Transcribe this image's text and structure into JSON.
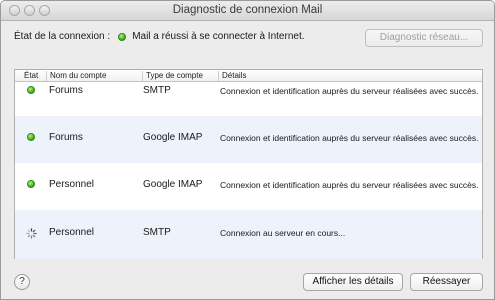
{
  "window": {
    "title": "Diagnostic de connexion Mail"
  },
  "status": {
    "label": "État de la connexion :",
    "message": "Mail a réussi à se connecter à Internet.",
    "state_color": "#3aa813"
  },
  "buttons": {
    "diagnostic": "Diagnostic réseau...",
    "show_details": "Afficher les détails",
    "retry": "Réessayer",
    "help": "?"
  },
  "table": {
    "columns": [
      "État",
      "Nom du compte",
      "Type de compte",
      "Détails"
    ],
    "rows": [
      {
        "state": "ok",
        "account": "Forums",
        "type": "SMTP",
        "details": "Connexion et identification auprès du serveur réalisées avec succès."
      },
      {
        "state": "ok",
        "account": "Forums",
        "type": "Google IMAP",
        "details": "Connexion et identification auprès du serveur réalisées avec succès."
      },
      {
        "state": "ok",
        "account": "Personnel",
        "type": "Google IMAP",
        "details": "Connexion et identification auprès du serveur réalisées avec succès."
      },
      {
        "state": "connecting",
        "account": "Personnel",
        "type": "SMTP",
        "details": "Connexion au serveur en cours..."
      }
    ]
  }
}
